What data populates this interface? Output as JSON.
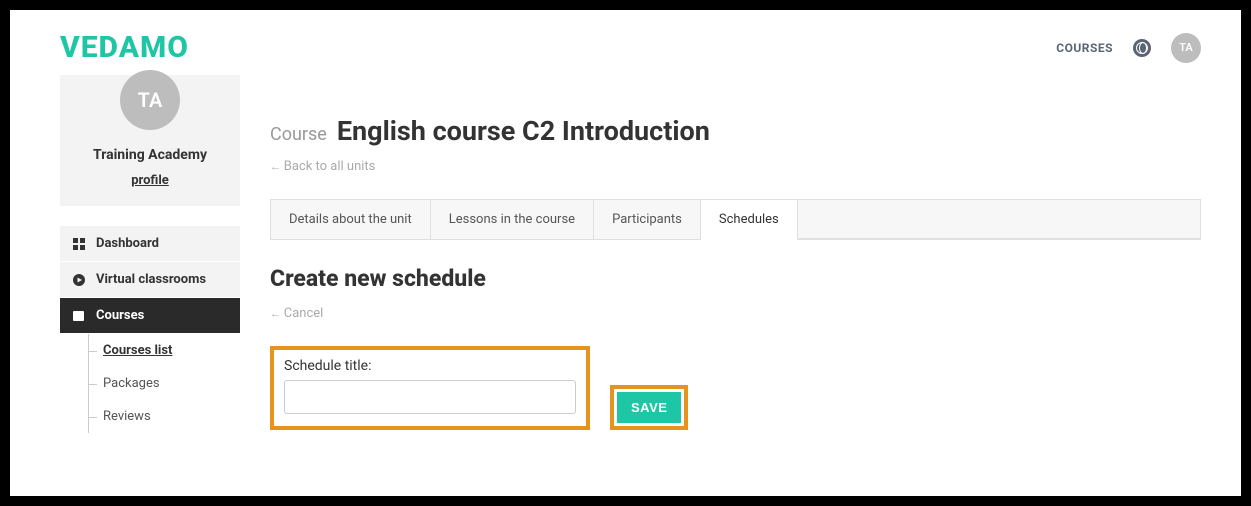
{
  "brand": "VEDAMO",
  "header": {
    "courses_link": "COURSES",
    "avatar_initials": "TA"
  },
  "sidebar": {
    "avatar_initials": "TA",
    "account_name": "Training Academy",
    "profile_link": "profile",
    "items": [
      {
        "label": "Dashboard"
      },
      {
        "label": "Virtual classrooms"
      },
      {
        "label": "Courses"
      }
    ],
    "sub_items": [
      {
        "label": "Courses list"
      },
      {
        "label": "Packages"
      },
      {
        "label": "Reviews"
      }
    ]
  },
  "content": {
    "course_prefix": "Course",
    "course_title": "English course C2 Introduction",
    "back_link": "Back to all units",
    "tabs": [
      {
        "label": "Details about the unit"
      },
      {
        "label": "Lessons in the course"
      },
      {
        "label": "Participants"
      },
      {
        "label": "Schedules"
      }
    ],
    "section_title": "Create new schedule",
    "cancel_link": "Cancel",
    "field_label": "Schedule title:",
    "schedule_title_value": "",
    "save_label": "SAVE"
  }
}
